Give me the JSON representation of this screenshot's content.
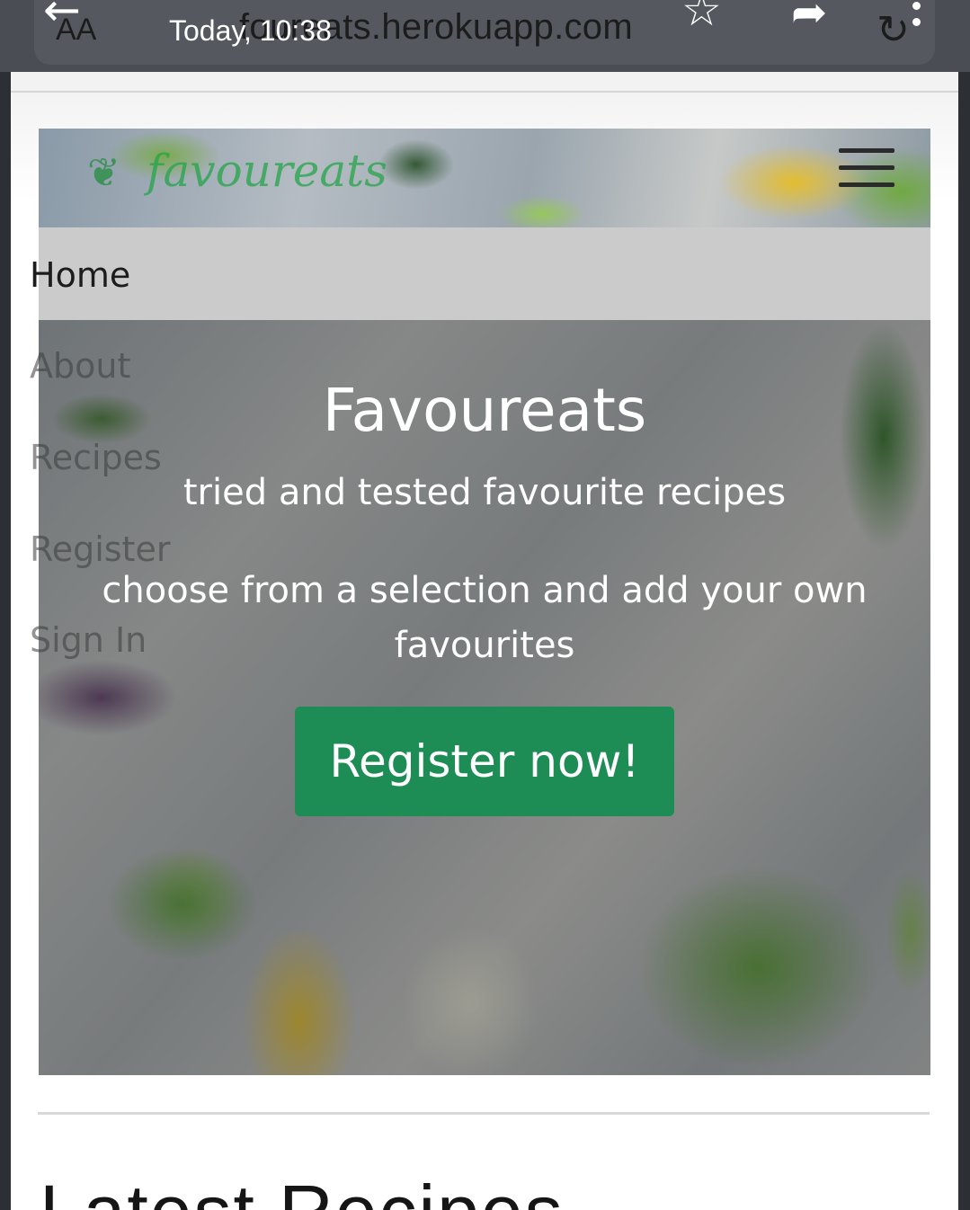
{
  "viewer": {
    "aa_label": "AA",
    "url": "foureats.herokuapp.com",
    "timestamp": "Today, 10:38",
    "icons": [
      "back-arrow-icon",
      "star-icon",
      "share-icon",
      "refresh-icon",
      "more-vert-icon"
    ]
  },
  "header": {
    "logo_text": "favoureats",
    "menu_icon": "hamburger-icon"
  },
  "nav": {
    "items": [
      {
        "label": "Home"
      },
      {
        "label": "About"
      },
      {
        "label": "Recipes"
      },
      {
        "label": "Register"
      },
      {
        "label": "Sign In"
      }
    ]
  },
  "hero": {
    "title": "Favoureats",
    "subtitle": "tried and tested favourite recipes",
    "description": "choose from a selection and add your own favourites",
    "cta_label": "Register now!"
  },
  "section": {
    "title": "Latest Recipes"
  },
  "colors": {
    "cta": "#1e8c55",
    "nav_band": "#cbcbcb",
    "topbar": "#4a4e54"
  }
}
